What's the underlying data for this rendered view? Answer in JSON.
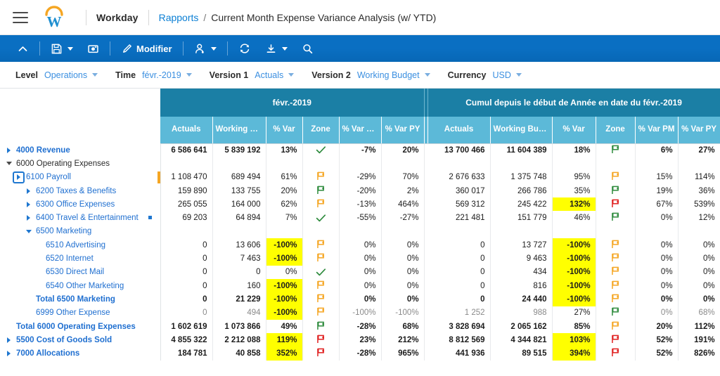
{
  "header": {
    "menu_icon": "hamburger-icon",
    "logo_icon": "workday-logo",
    "brand": "Workday",
    "breadcrumb_parent": "Rapports",
    "breadcrumb_sep": "/",
    "breadcrumb_current": "Current Month Expense Variance Analysis (w/ YTD)"
  },
  "toolbar": {
    "collapse_icon": "chevron-up-icon",
    "save_icon": "save-icon",
    "snapshot_icon": "camera-icon",
    "edit_icon": "pencil-icon",
    "edit_label": "Modifier",
    "assign_icon": "person-icon",
    "refresh_icon": "refresh-icon",
    "export_icon": "download-icon",
    "search_icon": "search-icon"
  },
  "filters": [
    {
      "label": "Level",
      "value": "Operations",
      "has_caret": true
    },
    {
      "label": "Time",
      "value": "févr.-2019",
      "has_caret": true
    },
    {
      "label": "Version 1",
      "value": "Actuals",
      "has_caret": true
    },
    {
      "label": "Version 2",
      "value": "Working Budget",
      "has_caret": true
    },
    {
      "label": "Currency",
      "value": "USD",
      "has_caret": true
    }
  ],
  "grid": {
    "group_headers": [
      "févr.-2019",
      "Cumul depuis le début de Année en date du févr.-2019"
    ],
    "columns_left": [
      "Actuals",
      "Working Budget",
      "% Var",
      "Zone",
      "% Var PM",
      "% Var PY"
    ],
    "columns_right": [
      "Actuals",
      "Working Bud...",
      "% Var",
      "Zone",
      "% Var PM",
      "% Var PY"
    ],
    "rows": [
      {
        "label": "4000 Revenue",
        "indent": 0,
        "twisty": "right",
        "bold": true,
        "dark": false,
        "left": {
          "actuals": "6 586 641",
          "budget": "5 839 192",
          "var": "13%",
          "zone": "check",
          "var_pm": "-7%",
          "var_py": "20%",
          "hl": false
        },
        "right": {
          "actuals": "13 700 466",
          "budget": "11 604 389",
          "var": "18%",
          "zone": "green",
          "var_pm": "6%",
          "var_py": "27%",
          "hl": false
        }
      },
      {
        "label": "6000 Operating Expenses",
        "indent": 0,
        "twisty": "down",
        "bold": false,
        "dark": true,
        "left": {
          "actuals": "",
          "budget": "",
          "var": "",
          "zone": "none",
          "var_pm": "",
          "var_py": "",
          "hl": false
        },
        "right": {
          "actuals": "",
          "budget": "",
          "var": "",
          "zone": "none",
          "var_pm": "",
          "var_py": "",
          "hl": false
        }
      },
      {
        "label": "6100 Payroll",
        "indent": 1,
        "twisty": "right-selected",
        "bold": false,
        "dark": false,
        "bar": true,
        "left": {
          "actuals": "1 108 470",
          "budget": "689 494",
          "var": "61%",
          "zone": "amber",
          "var_pm": "-29%",
          "var_py": "70%",
          "hl": false
        },
        "right": {
          "actuals": "2 676 633",
          "budget": "1 375 748",
          "var": "95%",
          "zone": "amber",
          "var_pm": "15%",
          "var_py": "114%",
          "hl": false
        }
      },
      {
        "label": "6200 Taxes & Benefits",
        "indent": 2,
        "twisty": "right",
        "bold": false,
        "dark": false,
        "left": {
          "actuals": "159 890",
          "budget": "133 755",
          "var": "20%",
          "zone": "green",
          "var_pm": "-20%",
          "var_py": "2%",
          "hl": false
        },
        "right": {
          "actuals": "360 017",
          "budget": "266 786",
          "var": "35%",
          "zone": "green",
          "var_pm": "19%",
          "var_py": "36%",
          "hl": false
        }
      },
      {
        "label": "6300 Office Expenses",
        "indent": 2,
        "twisty": "right",
        "bold": false,
        "dark": false,
        "left": {
          "actuals": "265 055",
          "budget": "164 000",
          "var": "62%",
          "zone": "amber",
          "var_pm": "-13%",
          "var_py": "464%",
          "hl": false
        },
        "right": {
          "actuals": "569 312",
          "budget": "245 422",
          "var": "132%",
          "zone": "red",
          "var_pm": "67%",
          "var_py": "539%",
          "hl": true
        }
      },
      {
        "label": "6400 Travel & Entertainment",
        "indent": 2,
        "twisty": "right",
        "bold": false,
        "dark": false,
        "dot": true,
        "left": {
          "actuals": "69 203",
          "budget": "64 894",
          "var": "7%",
          "zone": "check",
          "var_pm": "-55%",
          "var_py": "-27%",
          "hl": false
        },
        "right": {
          "actuals": "221 481",
          "budget": "151 779",
          "var": "46%",
          "zone": "green",
          "var_pm": "0%",
          "var_py": "12%",
          "hl": false
        }
      },
      {
        "label": "6500 Marketing",
        "indent": 2,
        "twisty": "down-blue",
        "bold": false,
        "dark": false,
        "left": {
          "actuals": "",
          "budget": "",
          "var": "",
          "zone": "none",
          "var_pm": "",
          "var_py": "",
          "hl": false
        },
        "right": {
          "actuals": "",
          "budget": "",
          "var": "",
          "zone": "none",
          "var_pm": "",
          "var_py": "",
          "hl": false
        }
      },
      {
        "label": "6510 Advertising",
        "indent": 3,
        "twisty": "none",
        "bold": false,
        "dark": false,
        "left": {
          "actuals": "0",
          "budget": "13 606",
          "var": "-100%",
          "zone": "amber",
          "var_pm": "0%",
          "var_py": "0%",
          "hl": true
        },
        "right": {
          "actuals": "0",
          "budget": "13 727",
          "var": "-100%",
          "zone": "amber",
          "var_pm": "0%",
          "var_py": "0%",
          "hl": true
        }
      },
      {
        "label": "6520 Internet",
        "indent": 3,
        "twisty": "none",
        "bold": false,
        "dark": false,
        "left": {
          "actuals": "0",
          "budget": "7 463",
          "var": "-100%",
          "zone": "amber",
          "var_pm": "0%",
          "var_py": "0%",
          "hl": true
        },
        "right": {
          "actuals": "0",
          "budget": "9 463",
          "var": "-100%",
          "zone": "amber",
          "var_pm": "0%",
          "var_py": "0%",
          "hl": true
        }
      },
      {
        "label": "6530 Direct Mail",
        "indent": 3,
        "twisty": "none",
        "bold": false,
        "dark": false,
        "left": {
          "actuals": "0",
          "budget": "0",
          "var": "0%",
          "zone": "check",
          "var_pm": "0%",
          "var_py": "0%",
          "hl": false
        },
        "right": {
          "actuals": "0",
          "budget": "434",
          "var": "-100%",
          "zone": "amber",
          "var_pm": "0%",
          "var_py": "0%",
          "hl": true
        }
      },
      {
        "label": "6540 Other Marketing",
        "indent": 3,
        "twisty": "none",
        "bold": false,
        "dark": false,
        "left": {
          "actuals": "0",
          "budget": "160",
          "var": "-100%",
          "zone": "amber",
          "var_pm": "0%",
          "var_py": "0%",
          "hl": true
        },
        "right": {
          "actuals": "0",
          "budget": "816",
          "var": "-100%",
          "zone": "amber",
          "var_pm": "0%",
          "var_py": "0%",
          "hl": true
        }
      },
      {
        "label": "Total 6500 Marketing",
        "indent": 2,
        "twisty": "none",
        "bold": true,
        "dark": false,
        "left": {
          "actuals": "0",
          "budget": "21 229",
          "var": "-100%",
          "zone": "amber",
          "var_pm": "0%",
          "var_py": "0%",
          "hl": true
        },
        "right": {
          "actuals": "0",
          "budget": "24 440",
          "var": "-100%",
          "zone": "amber",
          "var_pm": "0%",
          "var_py": "0%",
          "hl": true
        }
      },
      {
        "label": "6999 Other Expense",
        "indent": 2,
        "twisty": "none",
        "bold": false,
        "dark": false,
        "faint": true,
        "left": {
          "actuals": "0",
          "budget": "494",
          "var": "-100%",
          "zone": "amber",
          "var_pm": "-100%",
          "var_py": "-100%",
          "hl": true
        },
        "right": {
          "actuals": "1 252",
          "budget": "988",
          "var": "27%",
          "zone": "green",
          "var_pm": "0%",
          "var_py": "68%",
          "hl": false
        }
      },
      {
        "label": "Total 6000 Operating Expenses",
        "indent": 0,
        "twisty": "none",
        "bold": true,
        "dark": false,
        "left": {
          "actuals": "1 602 619",
          "budget": "1 073 866",
          "var": "49%",
          "zone": "green",
          "var_pm": "-28%",
          "var_py": "68%",
          "hl": false
        },
        "right": {
          "actuals": "3 828 694",
          "budget": "2 065 162",
          "var": "85%",
          "zone": "amber",
          "var_pm": "20%",
          "var_py": "112%",
          "hl": false
        }
      },
      {
        "label": "5500 Cost of Goods Sold",
        "indent": 0,
        "twisty": "right",
        "bold": true,
        "dark": false,
        "left": {
          "actuals": "4 855 322",
          "budget": "2 212 088",
          "var": "119%",
          "zone": "red",
          "var_pm": "23%",
          "var_py": "212%",
          "hl": true
        },
        "right": {
          "actuals": "8 812 569",
          "budget": "4 344 821",
          "var": "103%",
          "zone": "red",
          "var_pm": "52%",
          "var_py": "191%",
          "hl": true
        }
      },
      {
        "label": "7000 Allocations",
        "indent": 0,
        "twisty": "right",
        "bold": true,
        "dark": false,
        "left": {
          "actuals": "184 781",
          "budget": "40 858",
          "var": "352%",
          "zone": "red",
          "var_pm": "-28%",
          "var_py": "965%",
          "hl": true
        },
        "right": {
          "actuals": "441 936",
          "budget": "89 515",
          "var": "394%",
          "zone": "red",
          "var_pm": "52%",
          "var_py": "826%",
          "hl": true
        }
      }
    ]
  },
  "colors": {
    "brand_blue": "#0a6fc2",
    "link_blue": "#1f6fd0",
    "header_dark": "#1b7fa5",
    "header_light": "#5cb9d8",
    "highlight": "#FFFF00",
    "flag_green": "#2e8b3d",
    "flag_amber": "#f5a623",
    "flag_red": "#e02020",
    "logo_orange": "#f5a623",
    "logo_blue": "#1f8fd0"
  }
}
